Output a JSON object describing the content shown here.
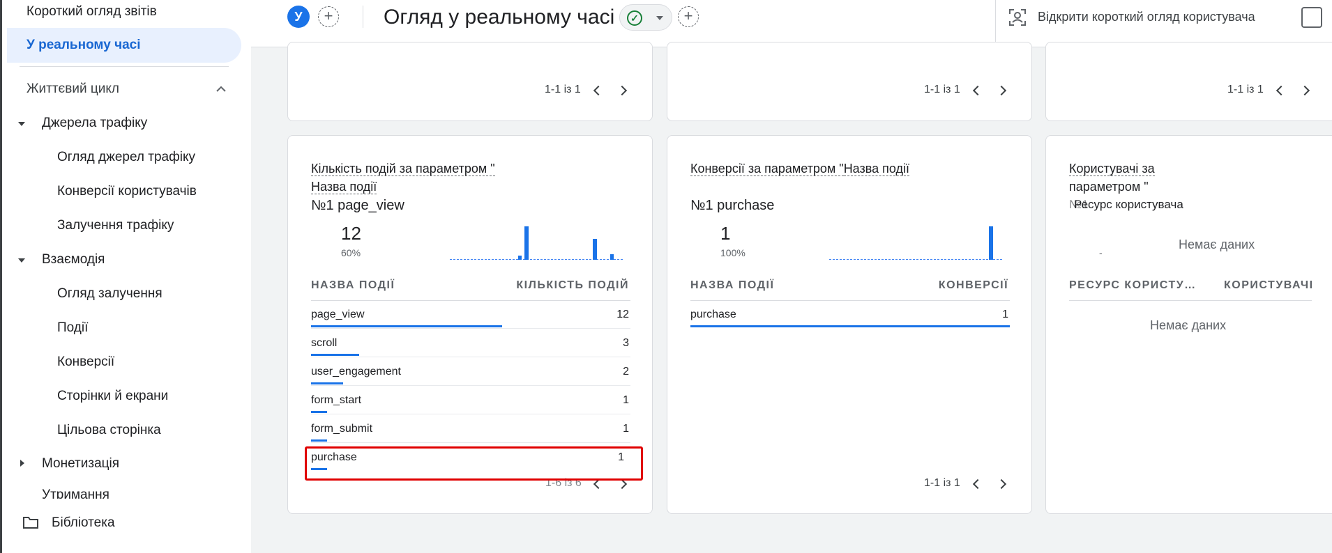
{
  "sidebar": {
    "items": [
      {
        "label": "Короткий огляд звітів"
      },
      {
        "label": "У реальному часі",
        "active": true
      },
      {
        "label": "Життєвий цикл"
      },
      {
        "label": "Джерела трафіку"
      },
      {
        "label": "Огляд джерел трафіку"
      },
      {
        "label": "Конверсії користувачів"
      },
      {
        "label": "Залучення трафіку"
      },
      {
        "label": "Взаємодія"
      },
      {
        "label": "Огляд залучення"
      },
      {
        "label": "Події"
      },
      {
        "label": "Конверсії"
      },
      {
        "label": "Сторінки й екрани"
      },
      {
        "label": "Цільова сторінка"
      },
      {
        "label": "Монетизація"
      },
      {
        "label": "Утримання"
      }
    ],
    "library": "Бібліотека"
  },
  "header": {
    "avatar_letter": "У",
    "title": "Огляд у реальному часі",
    "open_user_snapshot": "Відкрити короткий огляд користувача",
    "status_color": "#188038"
  },
  "top_cards": {
    "card1_pager": "1-1 із 1",
    "card2_pager": "1-1 із 1",
    "card3_pager": "1-1 із 1"
  },
  "events_card": {
    "title_part1": "Кількість подій за параметром \"",
    "title_part2": "Назва події",
    "top_rank": "№1",
    "top_item": "page_view",
    "top_value": "12",
    "top_percent": "60%",
    "col1": "НАЗВА ПОДІЇ",
    "col2": "КІЛЬКІСТЬ ПОДІЙ",
    "rows": [
      {
        "label": "page_view",
        "value": "12",
        "share": 1.0
      },
      {
        "label": "scroll",
        "value": "3",
        "share": 0.25
      },
      {
        "label": "user_engagement",
        "value": "2",
        "share": 0.167
      },
      {
        "label": "form_start",
        "value": "1",
        "share": 0.083
      },
      {
        "label": "form_submit",
        "value": "1",
        "share": 0.083
      },
      {
        "label": "purchase",
        "value": "1",
        "share": 0.083
      }
    ],
    "pager": "1-6 із 6",
    "accent": "#1a73e8"
  },
  "conversions_card": {
    "title_part1": "Конверсії за параметром \"",
    "title_part2": "Назва події",
    "top_rank": "№1",
    "top_item": "purchase",
    "top_value": "1",
    "top_percent": "100%",
    "col1": "НАЗВА ПОДІЇ",
    "col2": "КОНВЕРСІЇ",
    "rows": [
      {
        "label": "purchase",
        "value": "1",
        "share": 1.0
      }
    ],
    "pager": "1-1 із 1"
  },
  "users_card": {
    "title_line1": "Користувачі за",
    "title_line2": "параметром \"",
    "overlap_rank": "№1",
    "overlap_text": "Ресурс користувача",
    "dash": "-",
    "no_data_top": "Немає даних",
    "col1": "РЕСУРС КОРИСТУ…",
    "col2": "КОРИСТУВАЧІ",
    "no_data_table": "Немає даних"
  }
}
